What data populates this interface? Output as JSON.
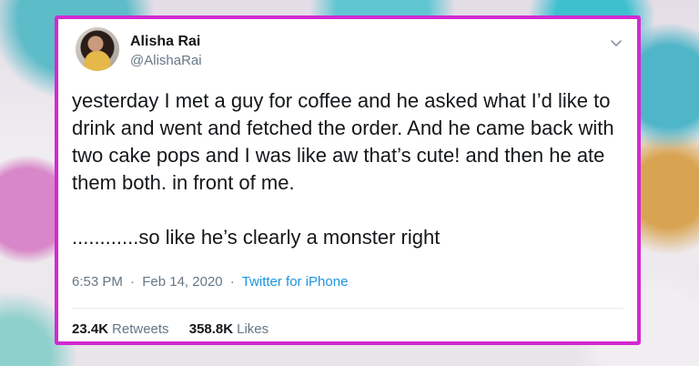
{
  "tweet": {
    "author_name": "Alisha Rai",
    "author_handle": "@AlishaRai",
    "text": "yesterday I met a guy for coffee and he asked what I’d like to drink and went and fetched the order. And he came back with two cake pops and I was like aw that’s cute! and then he ate them both. in front of me.\n\n............so like he’s clearly a monster right",
    "time": "6:53 PM",
    "date": "Feb 14, 2020",
    "separator": "·",
    "source": "Twitter for iPhone",
    "retweets_count": "23.4K",
    "retweets_label": "Retweets",
    "likes_count": "358.8K",
    "likes_label": "Likes"
  },
  "icons": {
    "menu": "chevron-down-icon"
  },
  "colors": {
    "card_border": "#d12ad1",
    "link": "#1b95e0",
    "secondary_text": "#657786",
    "primary_text": "#14171a"
  }
}
